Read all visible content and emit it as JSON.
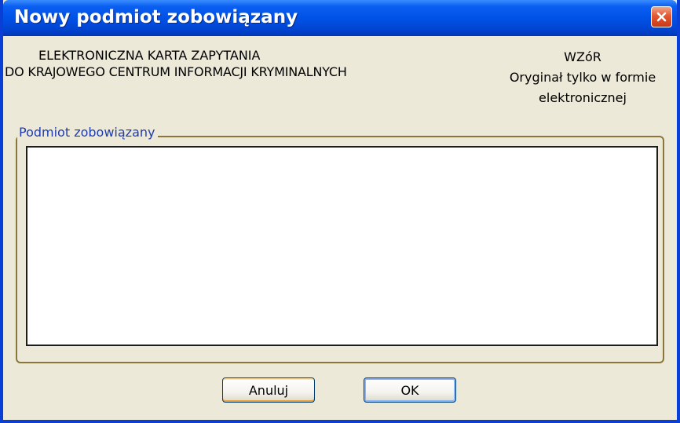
{
  "window": {
    "title": "Nowy podmiot zobowiązany",
    "close_icon": "close-icon"
  },
  "header": {
    "left_line1": "ELEKTRONICZNA KARTA ZAPYTANIA",
    "left_line2": "DO KRAJOWEGO CENTRUM INFORMACJI KRYMINALNYCH",
    "right_line1": "WZóR",
    "right_line2": "Oryginał tylko w formie",
    "right_line3": "elektronicznej"
  },
  "group": {
    "legend": "Podmiot zobowiązany"
  },
  "buttons": {
    "cancel_label": "Anuluj",
    "ok_label": "OK"
  },
  "colors": {
    "titlebar": "#0052e6",
    "window_border": "#0a3fd6",
    "face": "#ece9d8",
    "close_button": "#e2582f",
    "group_border": "#8a7638",
    "legend_text": "#1f3cb0"
  }
}
